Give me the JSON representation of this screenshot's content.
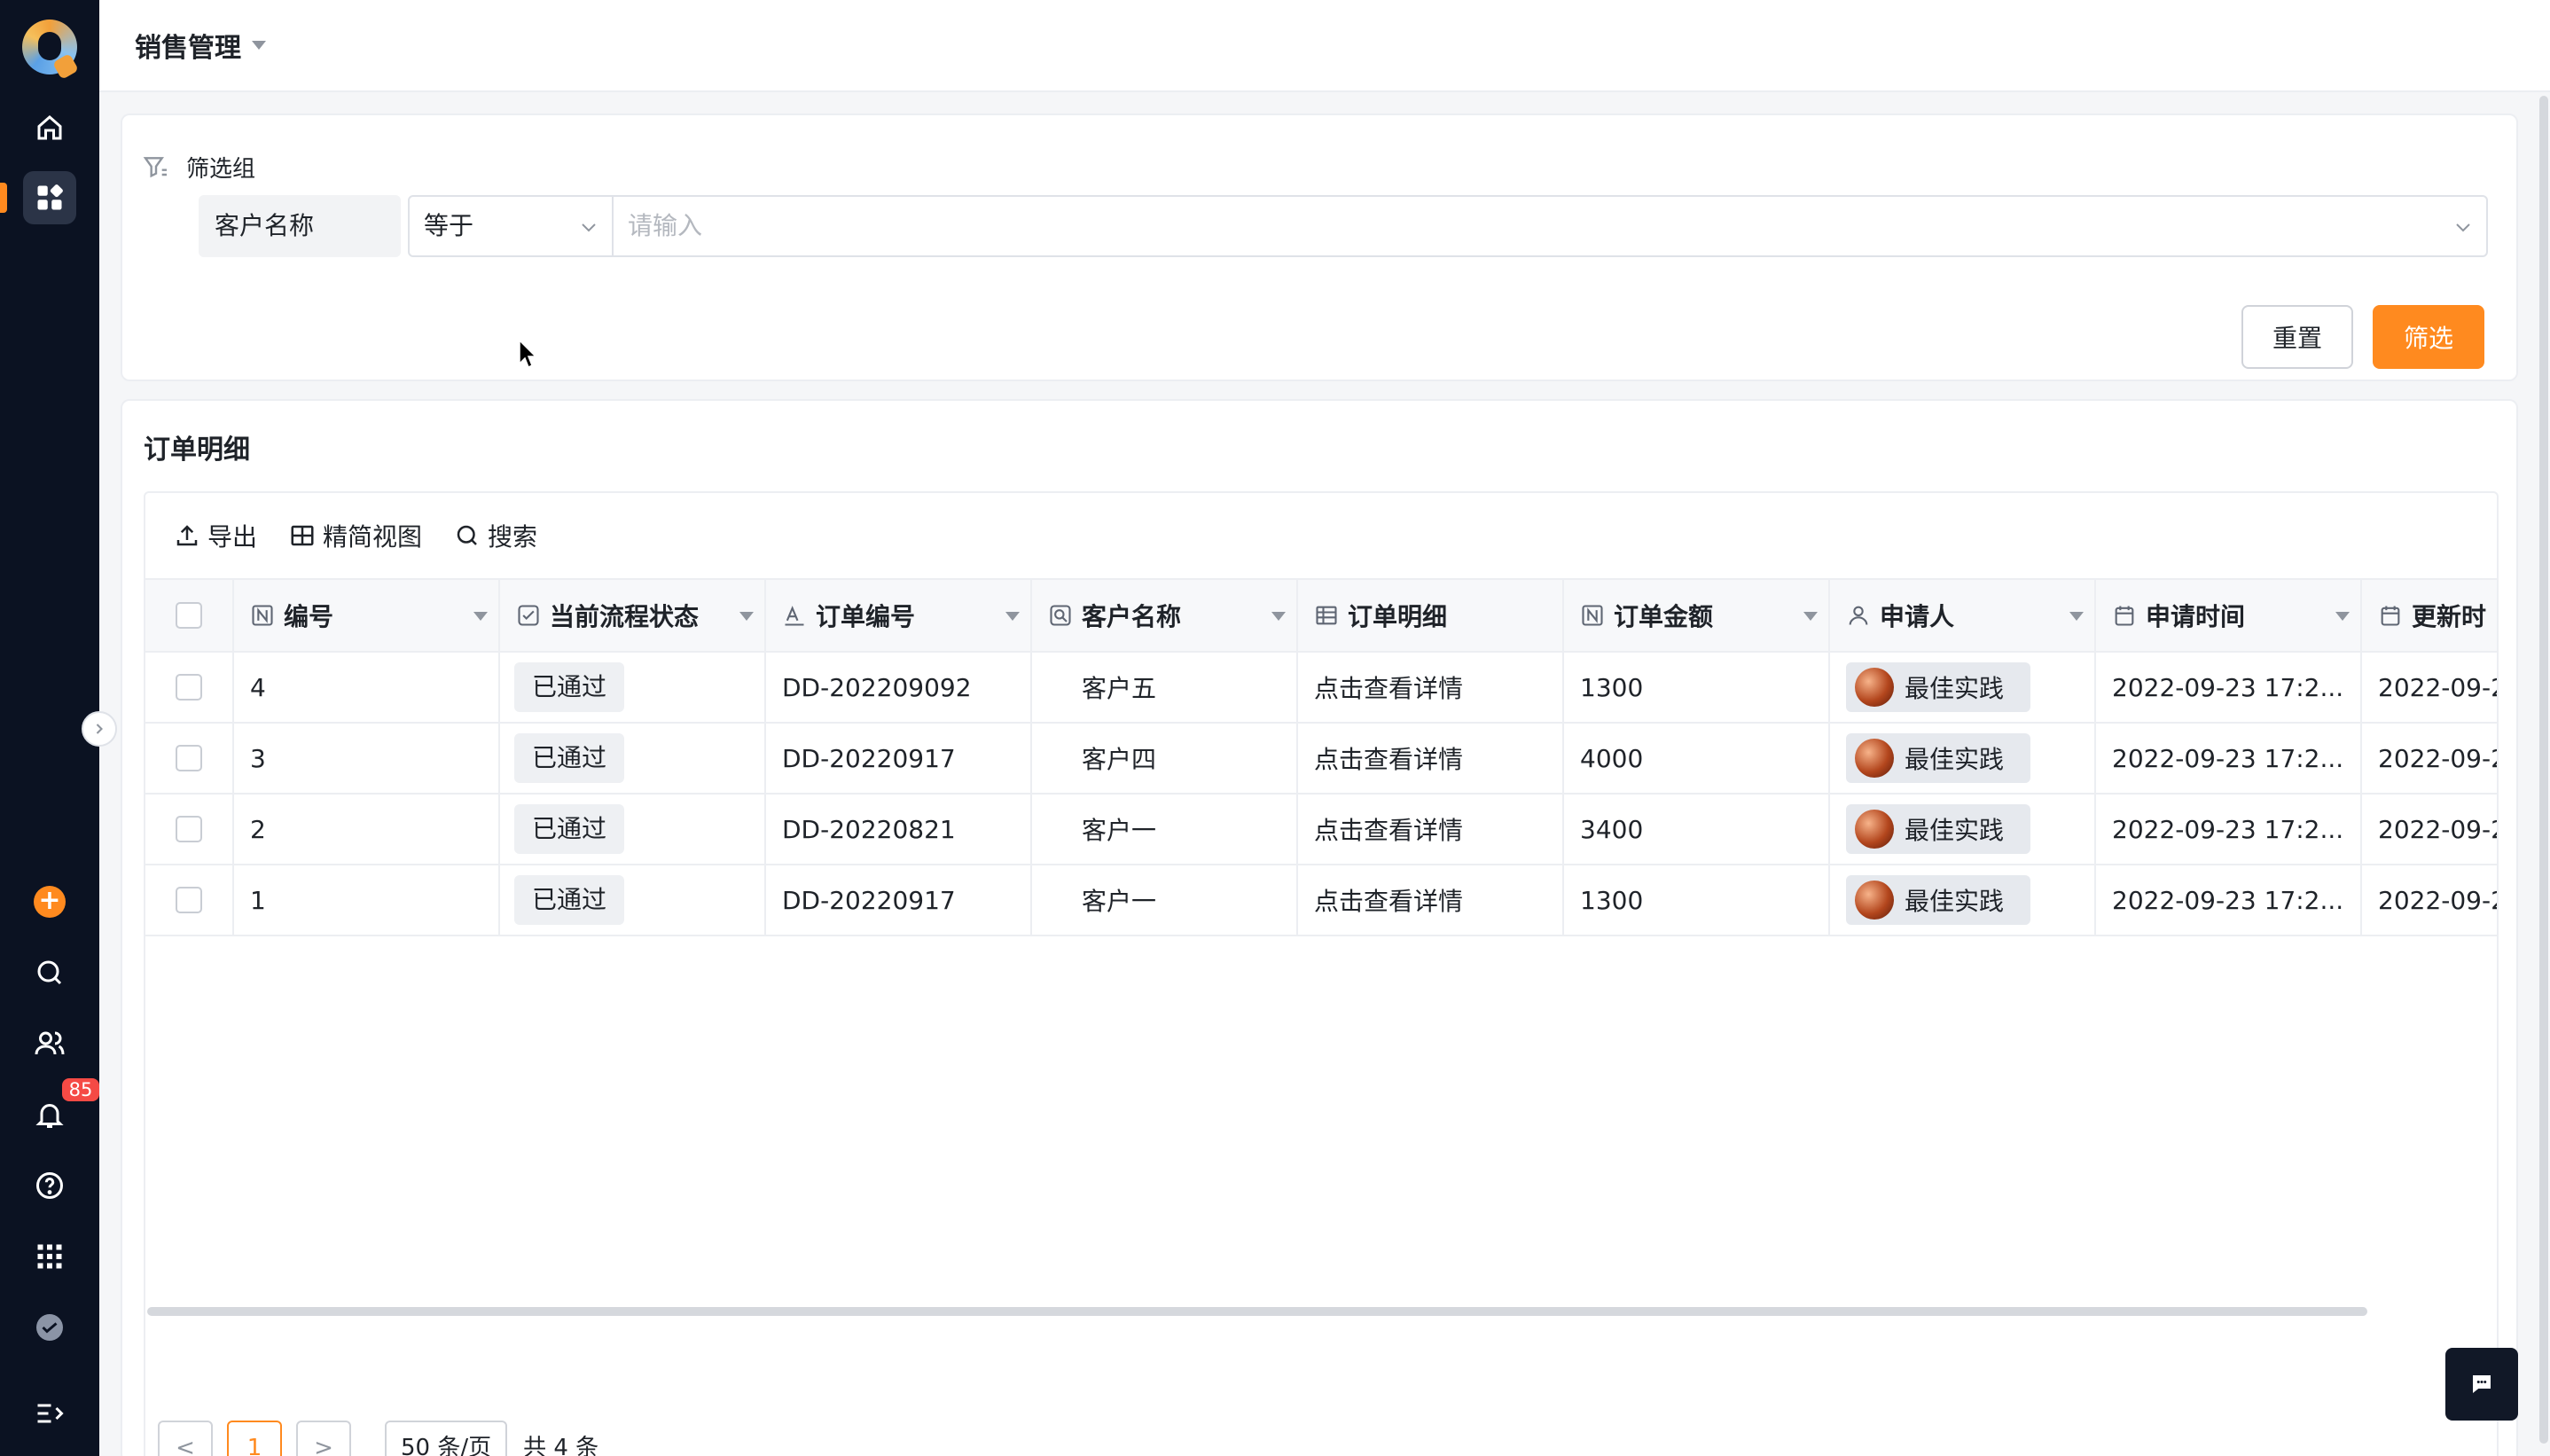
{
  "app": {
    "name": "Q"
  },
  "header": {
    "title": "销售管理"
  },
  "nav": {
    "items": [
      {
        "id": "home",
        "icon": "home-icon"
      },
      {
        "id": "apps",
        "icon": "grid-apps-icon",
        "active": true
      },
      {
        "id": "create",
        "icon": "plus-icon"
      },
      {
        "id": "search",
        "icon": "search-icon"
      },
      {
        "id": "contacts",
        "icon": "users-icon"
      },
      {
        "id": "notifications",
        "icon": "bell-icon",
        "badge": "85"
      },
      {
        "id": "help",
        "icon": "help-icon"
      },
      {
        "id": "app-center",
        "icon": "dots-grid-icon"
      },
      {
        "id": "workspace",
        "icon": "check-circle-icon"
      },
      {
        "id": "collapse",
        "icon": "collapse-icon"
      }
    ],
    "accent": "#ff8a1f"
  },
  "filter": {
    "group_title": "筛选组",
    "field_label": "客户名称",
    "operator": "等于",
    "value_placeholder": "请输入",
    "reset_label": "重置",
    "submit_label": "筛选"
  },
  "table": {
    "section_title": "订单明细",
    "toolbar": {
      "export": "导出",
      "compact_view": "精简视图",
      "search": "搜索"
    },
    "columns": [
      "编号",
      "当前流程状态",
      "订单编号",
      "客户名称",
      "订单明细",
      "订单金额",
      "申请人",
      "申请时间",
      "更新时"
    ],
    "rows": [
      {
        "id": "4",
        "status": "已通过",
        "order_no": "DD-202209092",
        "customer": "客户五",
        "detail": "点击查看详情",
        "amount": "1300",
        "applicant": "最佳实践",
        "applied_at": "2022-09-23 17:2...",
        "updated_at": "2022-09-2"
      },
      {
        "id": "3",
        "status": "已通过",
        "order_no": "DD-20220917",
        "customer": "客户四",
        "detail": "点击查看详情",
        "amount": "4000",
        "applicant": "最佳实践",
        "applied_at": "2022-09-23 17:2...",
        "updated_at": "2022-09-2"
      },
      {
        "id": "2",
        "status": "已通过",
        "order_no": "DD-20220821",
        "customer": "客户一",
        "detail": "点击查看详情",
        "amount": "3400",
        "applicant": "最佳实践",
        "applied_at": "2022-09-23 17:2...",
        "updated_at": "2022-09-2"
      },
      {
        "id": "1",
        "status": "已通过",
        "order_no": "DD-20220917",
        "customer": "客户一",
        "detail": "点击查看详情",
        "amount": "1300",
        "applicant": "最佳实践",
        "applied_at": "2022-09-23 17:2...",
        "updated_at": "2022-09-2"
      }
    ],
    "pagination": {
      "prev": "<",
      "current": "1",
      "next": ">",
      "page_size": "50 条/页",
      "total": "共 4 条"
    }
  }
}
